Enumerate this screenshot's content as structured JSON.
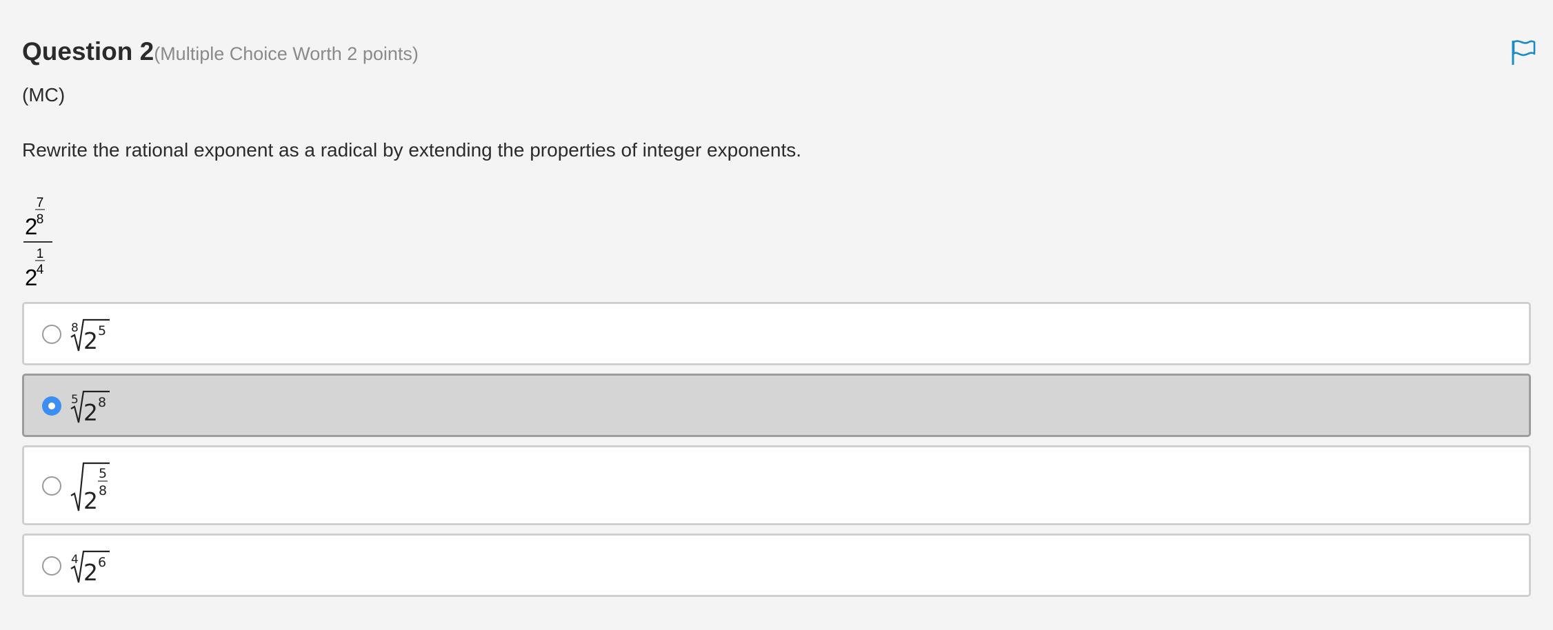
{
  "question": {
    "title": "Question 2",
    "worth": "(Multiple Choice Worth 2 points)",
    "tag": "(MC)",
    "prompt": "Rewrite the rational exponent as a radical by extending the properties of integer exponents.",
    "expression": {
      "numerator": {
        "base": "2",
        "exp_num": "7",
        "exp_den": "8"
      },
      "denominator": {
        "base": "2",
        "exp_num": "1",
        "exp_den": "4"
      }
    }
  },
  "icons": {
    "flag": "flag-icon"
  },
  "colors": {
    "accent": "#1a8bc4",
    "radio_selected": "#3c8ef1",
    "selected_bg": "#d5d5d5"
  },
  "options": [
    {
      "index": "8",
      "base": "2",
      "power": "5",
      "selected": false
    },
    {
      "index": "5",
      "base": "2",
      "power": "8",
      "selected": true
    },
    {
      "index": "",
      "base": "2",
      "power_num": "5",
      "power_den": "8",
      "selected": false
    },
    {
      "index": "4",
      "base": "2",
      "power": "6",
      "selected": false
    }
  ]
}
